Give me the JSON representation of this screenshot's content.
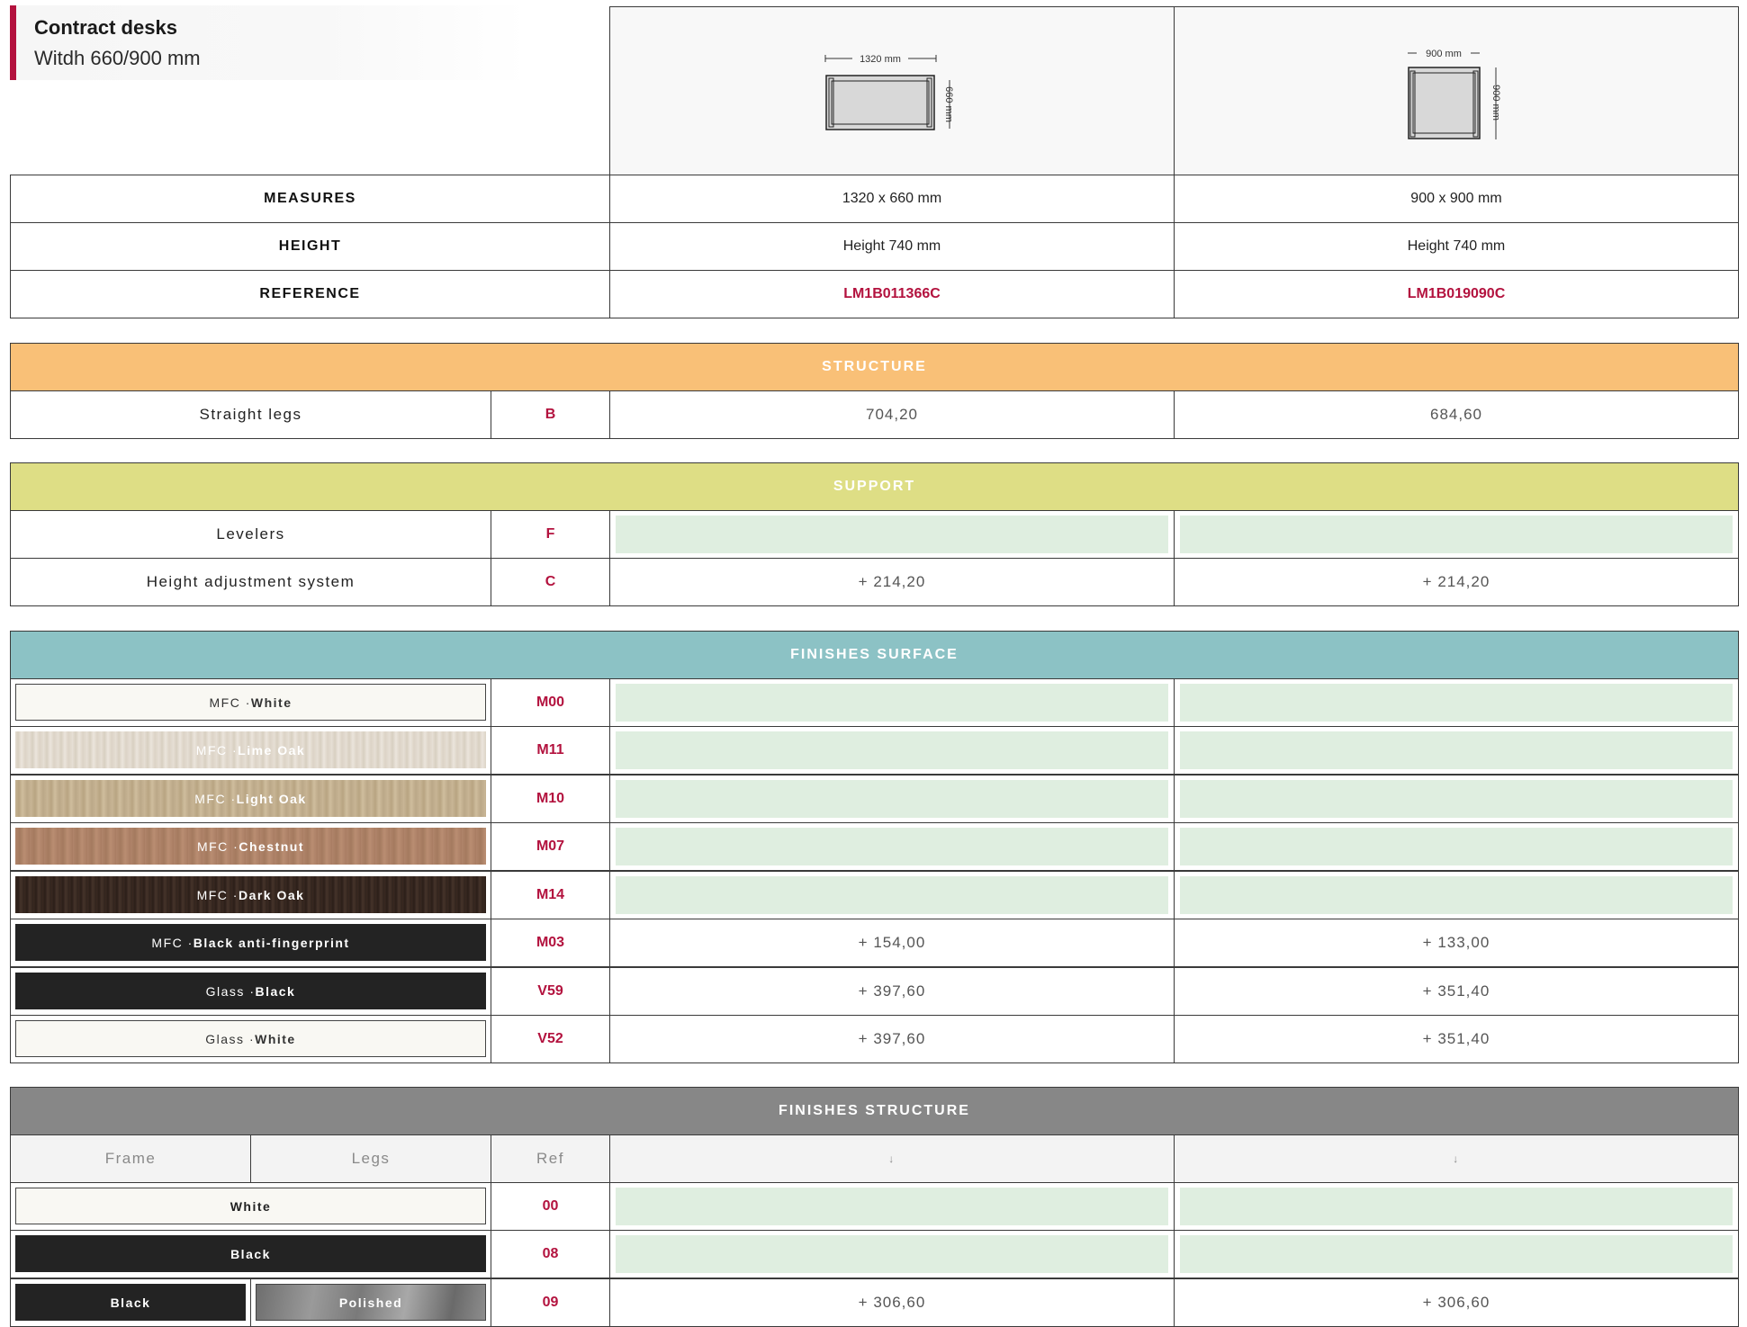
{
  "header": {
    "title": "Contract desks",
    "subtitle": "Witdh 660/900 mm"
  },
  "diagrams": [
    {
      "width_label": "1320 mm",
      "depth_label": "660 mm"
    },
    {
      "width_label": "900 mm",
      "depth_label": "900 mm"
    }
  ],
  "specs": {
    "measures_label": "MEASURES",
    "height_label": "HEIGHT",
    "reference_label": "REFERENCE",
    "products": [
      {
        "measures": "1320 x 660 mm",
        "height": "Height 740 mm",
        "reference": "LM1B011366C"
      },
      {
        "measures": "900 x 900 mm",
        "height": "Height 740 mm",
        "reference": "LM1B019090C"
      }
    ]
  },
  "structure": {
    "title": "STRUCTURE",
    "color": "#f9c077",
    "rows": [
      {
        "label": "Straight legs",
        "code": "B",
        "prices": [
          "704,20",
          "684,60"
        ]
      }
    ]
  },
  "support": {
    "title": "SUPPORT",
    "color": "#dede85",
    "rows": [
      {
        "label": "Levelers",
        "code": "F",
        "prices": [
          "",
          ""
        ]
      },
      {
        "label": "Height adjustment system",
        "code": "C",
        "prices": [
          "+ 214,20",
          "+ 214,20"
        ]
      }
    ]
  },
  "finishes_surface": {
    "title": "FINISHES SURFACE",
    "color": "#8cc2c5",
    "rows": [
      {
        "prefix": "MFC · ",
        "name": "White",
        "code": "M00",
        "swatch": "white",
        "prices": [
          "",
          ""
        ]
      },
      {
        "prefix": "MFC · ",
        "name": "Lime Oak",
        "code": "M11",
        "swatch": "lime-oak",
        "prices": [
          "",
          ""
        ]
      },
      {
        "prefix": "MFC · ",
        "name": "Light Oak",
        "code": "M10",
        "swatch": "light-oak",
        "prices": [
          "",
          ""
        ]
      },
      {
        "prefix": "MFC · ",
        "name": "Chestnut",
        "code": "M07",
        "swatch": "chestnut",
        "prices": [
          "",
          ""
        ]
      },
      {
        "prefix": "MFC · ",
        "name": "Dark Oak",
        "code": "M14",
        "swatch": "dark-oak",
        "prices": [
          "",
          ""
        ]
      },
      {
        "prefix": "MFC · ",
        "name": "Black anti-fingerprint",
        "code": "M03",
        "swatch": "black",
        "prices": [
          "+ 154,00",
          "+ 133,00"
        ]
      },
      {
        "prefix": "Glass · ",
        "name": "Black",
        "code": "V59",
        "swatch": "black",
        "prices": [
          "+ 397,60",
          "+ 351,40"
        ]
      },
      {
        "prefix": "Glass · ",
        "name": "White",
        "code": "V52",
        "swatch": "white",
        "prices": [
          "+ 397,60",
          "+ 351,40"
        ]
      }
    ]
  },
  "finishes_structure": {
    "title": "FINISHES STRUCTURE",
    "color": "#878787",
    "headers": {
      "frame": "Frame",
      "legs": "Legs",
      "ref": "Ref",
      "arrow1": "↓",
      "arrow2": "↓"
    },
    "rows": [
      {
        "label": "White",
        "code": "00",
        "prices": [
          "",
          ""
        ]
      },
      {
        "label": "Black",
        "code": "08",
        "prices": [
          "",
          ""
        ]
      },
      {
        "frame": "Black",
        "legs": "Polished",
        "code": "09",
        "prices": [
          "+ 306,60",
          "+ 306,60"
        ]
      }
    ]
  },
  "colors": {
    "accent": "#b3123e",
    "available_cell": "#dfeee0"
  }
}
